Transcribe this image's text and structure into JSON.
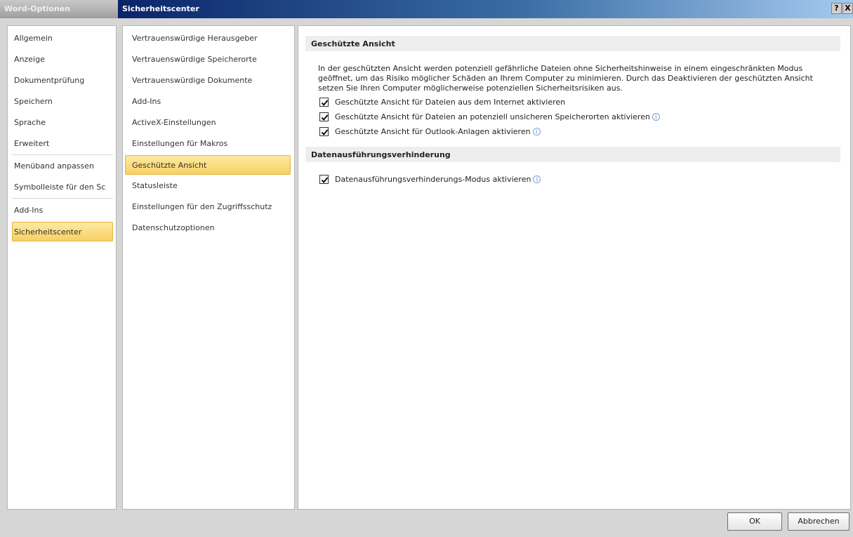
{
  "outer_window": {
    "title": "Word-Optionen",
    "nav_items": [
      {
        "label": "Allgemein"
      },
      {
        "label": "Anzeige"
      },
      {
        "label": "Dokumentprüfung"
      },
      {
        "label": "Speichern"
      },
      {
        "label": "Sprache"
      },
      {
        "label": "Erweitert"
      },
      {
        "label": "Menüband anpassen"
      },
      {
        "label": "Symbolleiste für den Sc"
      },
      {
        "label": "Add-Ins"
      },
      {
        "label": "Sicherheitscenter"
      }
    ],
    "selected_item": "Sicherheitscenter"
  },
  "dialog": {
    "title": "Sicherheitscenter",
    "help_button": "?",
    "close_button": "X",
    "nav_items": [
      {
        "label": "Vertrauenswürdige Herausgeber"
      },
      {
        "label": "Vertrauenswürdige Speicherorte"
      },
      {
        "label": "Vertrauenswürdige Dokumente"
      },
      {
        "label": "Add-Ins"
      },
      {
        "label": "ActiveX-Einstellungen"
      },
      {
        "label": "Einstellungen für Makros"
      },
      {
        "label": "Geschützte Ansicht"
      },
      {
        "label": "Statusleiste"
      },
      {
        "label": "Einstellungen für den Zugriffsschutz"
      },
      {
        "label": "Datenschutzoptionen"
      }
    ],
    "selected_item": "Geschützte Ansicht"
  },
  "content": {
    "section1": {
      "header": "Geschützte Ansicht",
      "description": "In der geschützten Ansicht werden potenziell gefährliche Dateien ohne Sicherheitshinweise in einem eingeschränkten Modus geöffnet, um das Risiko möglicher Schäden an Ihrem Computer zu minimieren. Durch das Deaktivieren der geschützten Ansicht setzen Sie Ihren Computer möglicherweise potenziellen Sicherheitsrisiken aus.",
      "options": [
        {
          "label": "Geschützte Ansicht für Dateien aus dem Internet aktivieren",
          "checked": true,
          "info": false
        },
        {
          "label": "Geschützte Ansicht für Dateien an potenziell unsicheren Speicherorten aktivieren",
          "checked": true,
          "info": true
        },
        {
          "label": "Geschützte Ansicht für Outlook-Anlagen aktivieren",
          "checked": true,
          "info": true
        }
      ]
    },
    "section2": {
      "header": "Datenausführungsverhinderung",
      "options": [
        {
          "label": "Datenausführungsverhinderungs-Modus aktivieren",
          "checked": true,
          "info": true
        }
      ]
    }
  },
  "buttons": {
    "ok": "OK",
    "cancel": "Abbrechen"
  },
  "icons": {
    "checkmark": "check-icon",
    "info": "info-icon"
  }
}
